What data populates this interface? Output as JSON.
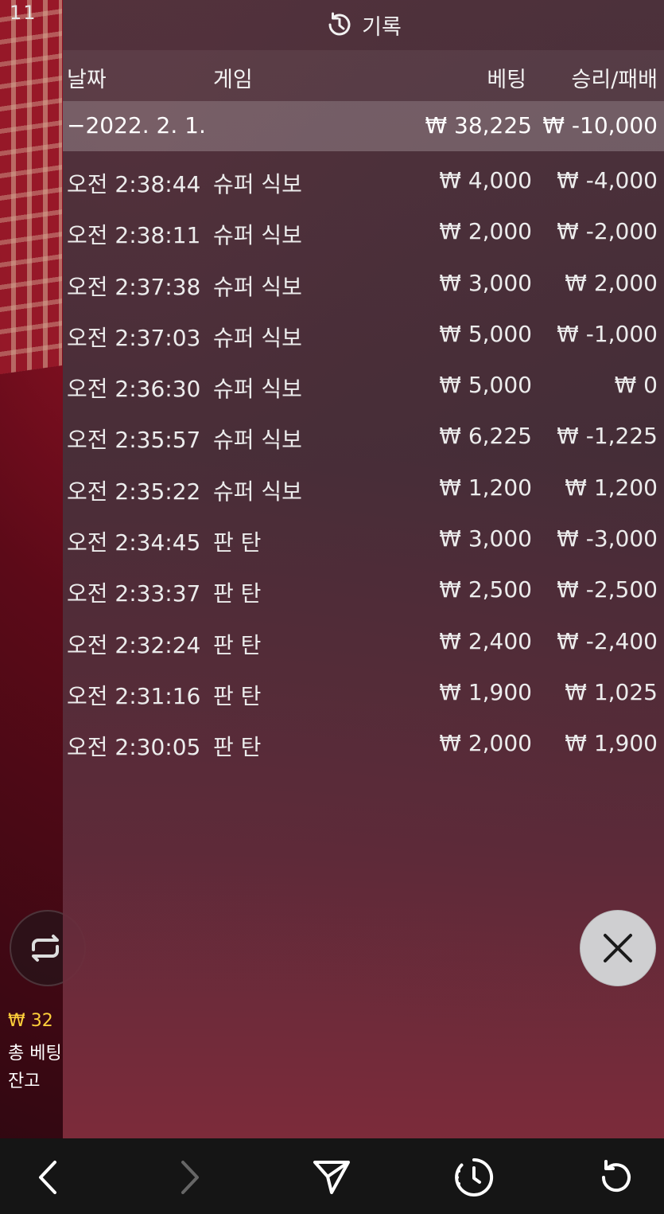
{
  "status_bar": {
    "time": "11"
  },
  "panel": {
    "title": "기록",
    "columns": {
      "date": "날짜",
      "game": "게임",
      "bet": "베팅",
      "result": "승리/패배"
    },
    "date_group": {
      "label": "−2022. 2. 1.",
      "bet": "₩ 38,225",
      "result": "₩ -10,000"
    },
    "rows": [
      {
        "time": "오전 2:38:44",
        "game": "슈퍼 식보",
        "bet": "₩ 4,000",
        "result": "₩ -4,000"
      },
      {
        "time": "오전 2:38:11",
        "game": "슈퍼 식보",
        "bet": "₩ 2,000",
        "result": "₩ -2,000"
      },
      {
        "time": "오전 2:37:38",
        "game": "슈퍼 식보",
        "bet": "₩ 3,000",
        "result": "₩ 2,000"
      },
      {
        "time": "오전 2:37:03",
        "game": "슈퍼 식보",
        "bet": "₩ 5,000",
        "result": "₩ -1,000"
      },
      {
        "time": "오전 2:36:30",
        "game": "슈퍼 식보",
        "bet": "₩ 5,000",
        "result": "₩ 0"
      },
      {
        "time": "오전 2:35:57",
        "game": "슈퍼 식보",
        "bet": "₩ 6,225",
        "result": "₩ -1,225"
      },
      {
        "time": "오전 2:35:22",
        "game": "슈퍼 식보",
        "bet": "₩ 1,200",
        "result": "₩ 1,200"
      },
      {
        "time": "오전 2:34:45",
        "game": "판 탄",
        "bet": "₩ 3,000",
        "result": "₩ -3,000"
      },
      {
        "time": "오전 2:33:37",
        "game": "판 탄",
        "bet": "₩ 2,500",
        "result": "₩ -2,500"
      },
      {
        "time": "오전 2:32:24",
        "game": "판 탄",
        "bet": "₩ 2,400",
        "result": "₩ -2,400"
      },
      {
        "time": "오전 2:31:16",
        "game": "판 탄",
        "bet": "₩ 1,900",
        "result": "₩ 1,025"
      },
      {
        "time": "오전 2:30:05",
        "game": "판 탄",
        "bet": "₩ 2,000",
        "result": "₩ 1,900"
      }
    ]
  },
  "game_bg": {
    "balance": "₩ 32",
    "total_bet": "총 베팅",
    "remaining": "잔고"
  },
  "icons": {
    "history": "clock-history-icon",
    "close": "close-icon",
    "back": "chevron-left-icon",
    "forward": "chevron-right-icon",
    "share": "send-icon",
    "timer": "timer-icon",
    "reload": "reload-icon",
    "repeat": "repeat-icon"
  },
  "colors": {
    "balance": "#ffcf3a",
    "close_bg": "#cfcfd1",
    "bottom_bar": "#151515"
  }
}
